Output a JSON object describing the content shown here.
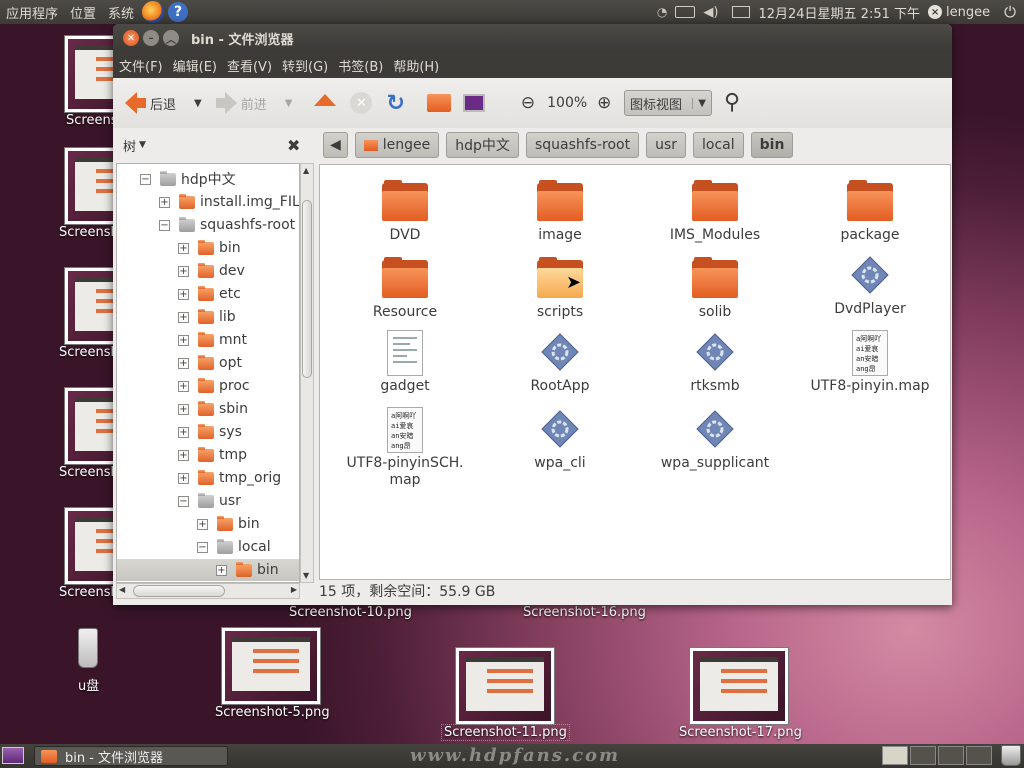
{
  "top_panel": {
    "applications": "应用程序",
    "places": "位置",
    "system": "系统",
    "datetime": "12月24日星期五 2:51 下午",
    "user": "lengee"
  },
  "desktop": {
    "left_icons": [
      "Screens",
      "Screensh",
      "Screensh",
      "Screensh",
      "Screensh"
    ],
    "usb_label": "u盘",
    "thumbs": [
      {
        "label": "Screenshot-10.png"
      },
      {
        "label": "Screenshot-16.png"
      },
      {
        "label": "Screenshot-5.png"
      },
      {
        "label": "Screenshot-11.png"
      },
      {
        "label": "Screenshot-17.png"
      }
    ]
  },
  "window": {
    "title": "bin - 文件浏览器",
    "menu": [
      "文件(F)",
      "编辑(E)",
      "查看(V)",
      "转到(G)",
      "书签(B)",
      "帮助(H)"
    ],
    "toolbar": {
      "back": "后退",
      "forward": "前进",
      "zoom": "100%",
      "view_mode": "图标视图"
    },
    "sidebar": {
      "mode": "树"
    },
    "tree": [
      {
        "label": "hdp中文",
        "exp": "−"
      },
      {
        "label": "install.img_FILE",
        "exp": "+"
      },
      {
        "label": "squashfs-root",
        "exp": "−"
      },
      {
        "label": "bin",
        "exp": "+"
      },
      {
        "label": "dev",
        "exp": "+"
      },
      {
        "label": "etc",
        "exp": "+"
      },
      {
        "label": "lib",
        "exp": "+"
      },
      {
        "label": "mnt",
        "exp": "+"
      },
      {
        "label": "opt",
        "exp": "+"
      },
      {
        "label": "proc",
        "exp": "+"
      },
      {
        "label": "sbin",
        "exp": "+"
      },
      {
        "label": "sys",
        "exp": "+"
      },
      {
        "label": "tmp",
        "exp": "+"
      },
      {
        "label": "tmp_orig",
        "exp": "+"
      },
      {
        "label": "usr",
        "exp": "−"
      },
      {
        "label": "bin",
        "exp": "+"
      },
      {
        "label": "local",
        "exp": "−"
      },
      {
        "label": "bin",
        "exp": "+"
      }
    ],
    "path": [
      "lengee",
      "hdp中文",
      "squashfs-root",
      "usr",
      "local",
      "bin"
    ],
    "files": [
      {
        "name": "DVD",
        "kind": "folder"
      },
      {
        "name": "image",
        "kind": "folder"
      },
      {
        "name": "IMS_Modules",
        "kind": "folder"
      },
      {
        "name": "package",
        "kind": "folder"
      },
      {
        "name": "Resource",
        "kind": "folder"
      },
      {
        "name": "scripts",
        "kind": "folder-light"
      },
      {
        "name": "solib",
        "kind": "folder"
      },
      {
        "name": "DvdPlayer",
        "kind": "exec"
      },
      {
        "name": "gadget",
        "kind": "text"
      },
      {
        "name": "RootApp",
        "kind": "exec"
      },
      {
        "name": "rtksmb",
        "kind": "exec"
      },
      {
        "name": "UTF8-pinyin.map",
        "kind": "cjk"
      },
      {
        "name": "UTF8-pinyinSCH.\nmap",
        "kind": "cjk"
      },
      {
        "name": "wpa_cli",
        "kind": "exec"
      },
      {
        "name": "wpa_supplicant",
        "kind": "exec"
      }
    ],
    "cjk_preview": "a阿啊吖\nai爱哀\nan安暗\nang昂",
    "status": "15 项，剩余空间：55.9 GB"
  },
  "bottom_panel": {
    "task_label": "bin - 文件浏览器",
    "watermark": "www.hdpfans.com"
  }
}
